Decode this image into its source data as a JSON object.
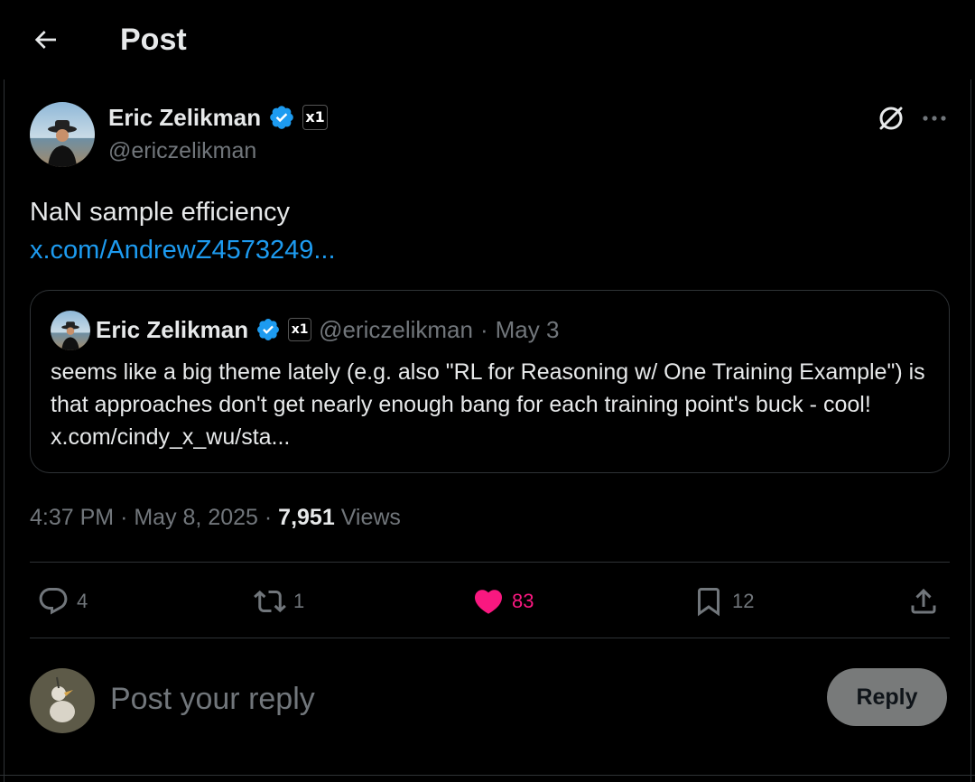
{
  "header": {
    "title": "Post",
    "back_icon": "arrow-left-icon"
  },
  "post": {
    "author": {
      "name": "Eric Zelikman",
      "handle": "@ericzelikman",
      "verified": true,
      "affiliation_badge": "x1"
    },
    "text": "NaN sample efficiency",
    "link": "x.com/AndrewZ4573249...",
    "time": "4:37 PM",
    "date": "May 8, 2025",
    "views_count": "7,951",
    "views_label": "Views",
    "separator": "·"
  },
  "quote": {
    "name": "Eric Zelikman",
    "handle": "@ericzelikman",
    "separator": "·",
    "date": "May 3",
    "text": "seems like a big theme lately (e.g. also \"RL for Reasoning w/ One Training Example\") is that approaches don't get nearly enough bang for each training point's buck - cool! x.com/cindy_x_wu/sta..."
  },
  "actions": {
    "replies": "4",
    "reposts": "1",
    "likes": "83",
    "bookmarks": "12"
  },
  "reply_box": {
    "placeholder": "Post your reply",
    "button_label": "Reply"
  },
  "colors": {
    "background": "#000000",
    "link": "#1d9bf0",
    "like": "#f91880",
    "verified": "#1d9bf0",
    "muted": "#71767b"
  }
}
